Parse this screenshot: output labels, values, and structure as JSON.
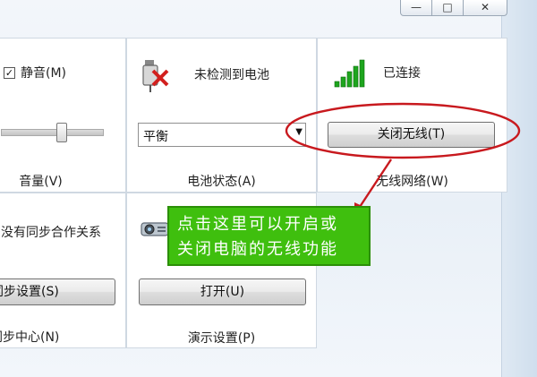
{
  "window": {
    "minimize_glyph": "—",
    "maximize_glyph": "□",
    "close_glyph": "✕"
  },
  "volume_tile": {
    "mute_checkbox_mark": "✓",
    "mute_label": "静音(M)",
    "caption": "音量(V)"
  },
  "battery_tile": {
    "status_text": "未检测到电池",
    "power_plan_value": "平衡",
    "caption": "电池状态(A)"
  },
  "wireless_tile": {
    "status_text": "已连接",
    "toggle_button_label": "关闭无线(T)",
    "caption": "无线网络(W)"
  },
  "sync_tile": {
    "status_text": "没有同步合作关系",
    "settings_button_label": "同步设置(S)",
    "caption": "同步中心(N)"
  },
  "presentation_tile": {
    "open_button_label": "打开(U)",
    "caption": "演示设置(P)"
  },
  "annotation": {
    "line1": "点击这里可以开启或",
    "line2": "关闭电脑的无线功能",
    "highlight_color": "#c8191e",
    "callout_color": "#3fbf0e"
  }
}
